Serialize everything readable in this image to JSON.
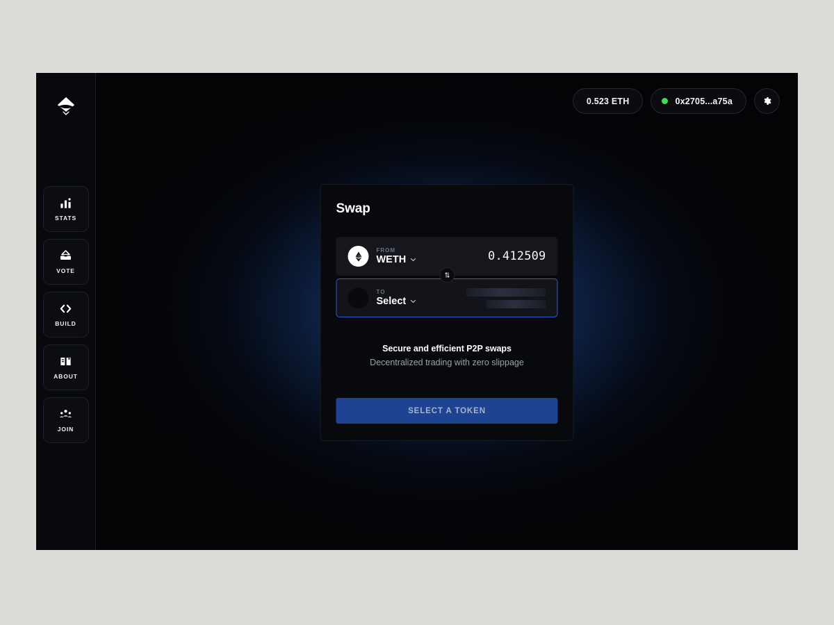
{
  "app": {
    "logo_icon": "diamond-slash-logo"
  },
  "sidebar": {
    "items": [
      {
        "label": "STATS",
        "icon": "bar-chart-icon"
      },
      {
        "label": "VOTE",
        "icon": "ballot-box-icon"
      },
      {
        "label": "BUILD",
        "icon": "code-brackets-icon"
      },
      {
        "label": "ABOUT",
        "icon": "open-book-icon"
      },
      {
        "label": "JOIN",
        "icon": "people-group-icon"
      }
    ]
  },
  "header": {
    "balance": "0.523 ETH",
    "wallet_address": "0x2705...a75a",
    "status_dot_color": "#3ddc5f",
    "settings_icon": "gear-icon"
  },
  "swap": {
    "title": "Swap",
    "from": {
      "caption": "FROM",
      "symbol": "WETH",
      "amount": "0.412509",
      "token_icon": "ethereum-icon",
      "chevron_icon": "chevron-down-icon"
    },
    "to": {
      "caption": "TO",
      "symbol": "Select",
      "token_icon": "empty-token-icon",
      "chevron_icon": "chevron-down-icon",
      "loading": true
    },
    "toggle_icon": "swap-vertical-icon",
    "tagline_main": "Secure and efficient P2P swaps",
    "tagline_sub": "Decentralized trading with zero slippage",
    "action_label": "SELECT A TOKEN",
    "action_color": "#1e4393",
    "focus_border_color": "#2f5fd0"
  }
}
